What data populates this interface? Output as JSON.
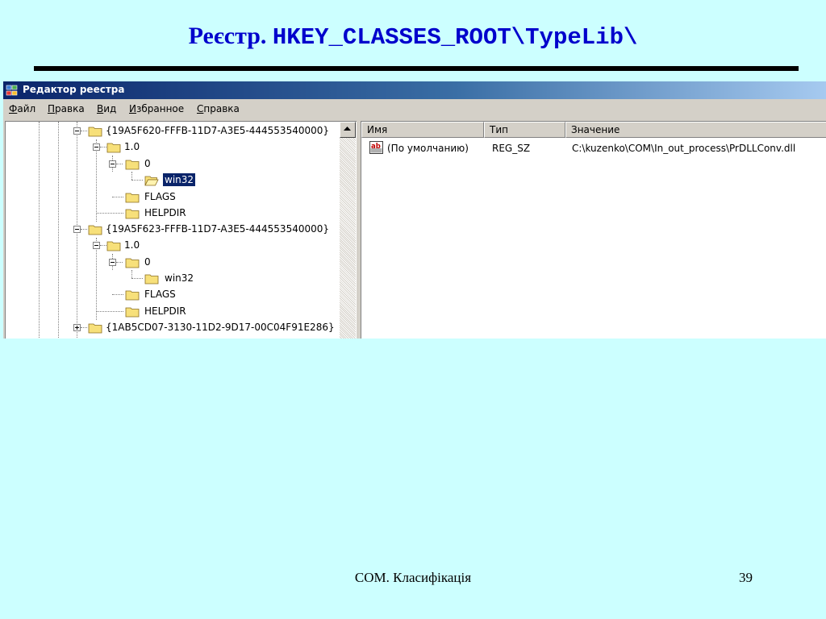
{
  "slide": {
    "title_prefix": "Реєстр.",
    "title_path": "HKEY_CLASSES_ROOT\\TypeLib\\",
    "footer": "COM. Класифікація",
    "page_number": "39"
  },
  "window": {
    "title": "Редактор реестра",
    "menu": [
      {
        "accel": "Ф",
        "rest": "айл"
      },
      {
        "accel": "П",
        "rest": "равка"
      },
      {
        "accel": "В",
        "rest": "ид"
      },
      {
        "accel": "И",
        "rest": "збранное"
      },
      {
        "accel": "С",
        "rest": "правка"
      }
    ]
  },
  "tree": {
    "nodes": [
      {
        "label": "{19A5F620-FFFB-11D7-A3E5-444553540000}",
        "expanded": true,
        "selected": false,
        "icon": "folder-icon"
      },
      {
        "label": "1.0",
        "expanded": true,
        "selected": false,
        "icon": "folder-icon"
      },
      {
        "label": "0",
        "expanded": true,
        "selected": false,
        "icon": "folder-icon"
      },
      {
        "label": "win32",
        "expanded": false,
        "selected": true,
        "icon": "folder-open-icon"
      },
      {
        "label": "FLAGS",
        "expanded": false,
        "selected": false,
        "icon": "folder-icon"
      },
      {
        "label": "HELPDIR",
        "expanded": false,
        "selected": false,
        "icon": "folder-icon"
      },
      {
        "label": "{19A5F623-FFFB-11D7-A3E5-444553540000}",
        "expanded": true,
        "selected": false,
        "icon": "folder-icon"
      },
      {
        "label": "1.0",
        "expanded": true,
        "selected": false,
        "icon": "folder-icon"
      },
      {
        "label": "0",
        "expanded": true,
        "selected": false,
        "icon": "folder-icon"
      },
      {
        "label": "win32",
        "expanded": false,
        "selected": false,
        "icon": "folder-icon"
      },
      {
        "label": "FLAGS",
        "expanded": false,
        "selected": false,
        "icon": "folder-icon"
      },
      {
        "label": "HELPDIR",
        "expanded": false,
        "selected": false,
        "icon": "folder-icon"
      },
      {
        "label": "{1AB5CD07-3130-11D2-9D17-00C04F91E286}",
        "expanded": false,
        "selected": false,
        "icon": "folder-icon"
      }
    ]
  },
  "list": {
    "columns": [
      "Имя",
      "Тип",
      "Значение"
    ],
    "rows": [
      {
        "name": "(По умолчанию)",
        "type": "REG_SZ",
        "value": "C:\\kuzenko\\COM\\In_out_process\\PrDLLConv.dll",
        "icon": "string-value-icon"
      }
    ]
  },
  "colors": {
    "slide_background": "#ccffff",
    "title_color": "#0000cc",
    "selection": "#0a246a"
  }
}
